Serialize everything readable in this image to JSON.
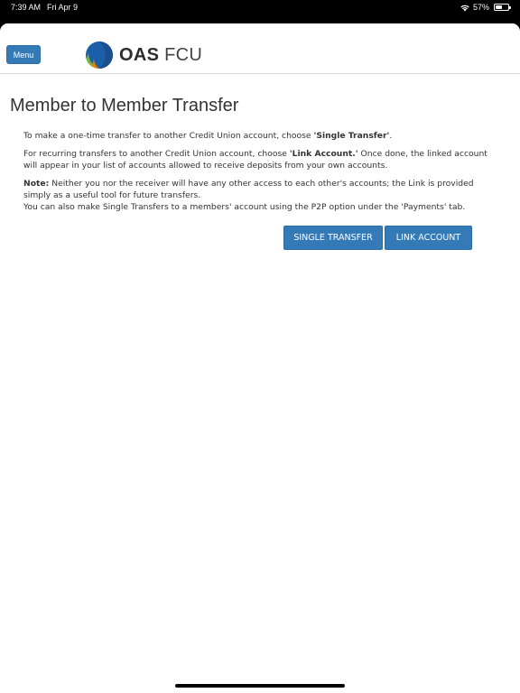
{
  "status_bar": {
    "time": "7:39 AM",
    "date": "Fri Apr 9",
    "battery": "57%",
    "battery_level": 0.57
  },
  "header": {
    "menu_label": "Menu",
    "logo_bold": "OAS",
    "logo_light": " FCU"
  },
  "page": {
    "title": "Member to Member Transfer",
    "p1_text": "To make a one-time transfer to another Credit Union account, choose ",
    "p1_bold": "'Single Transfer'",
    "p1_end": ".",
    "p2_text": "For recurring transfers to another Credit Union account, choose ",
    "p2_bold": "'Link Account.'",
    "p2_end": " Once done, the linked account will appear in your list of accounts allowed to receive deposits from your own accounts.",
    "note_label": "Note:",
    "note_text": " Neither you nor the receiver will have any other access to each other's accounts; the Link is provided simply as a useful tool for future transfers.",
    "p4_text": "You can also make Single Transfers to a members' account using the P2P option under the 'Payments' tab."
  },
  "buttons": {
    "single_transfer": "SINGLE TRANSFER",
    "link_account": "LINK ACCOUNT"
  },
  "colors": {
    "primary_button": "#337ab7",
    "logo_blue": "#1a5fa8",
    "logo_green": "#7cb342",
    "logo_orange": "#f57c00"
  }
}
